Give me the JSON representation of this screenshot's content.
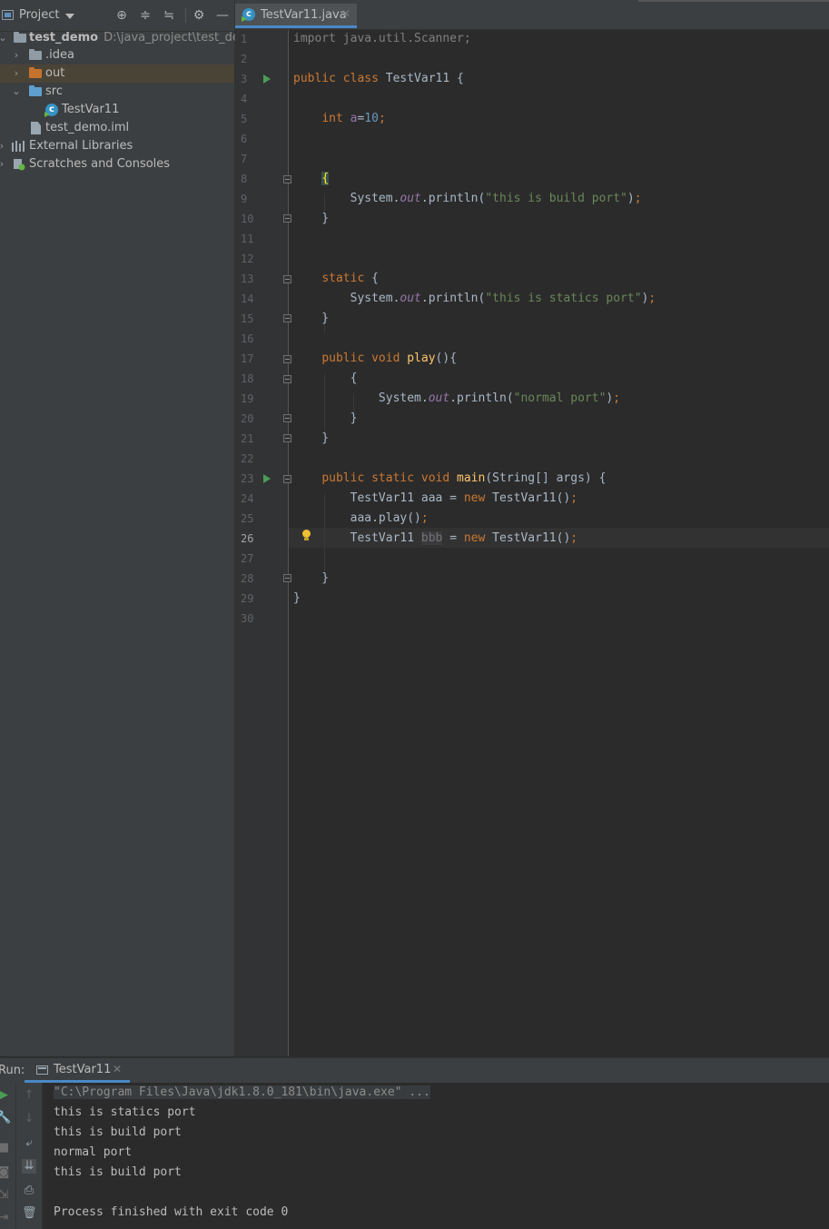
{
  "project_panel": {
    "title": "Project",
    "tree": [
      {
        "label": "test_demo",
        "note": "D:\\java_project\\test_demo"
      },
      {
        "label": ".idea"
      },
      {
        "label": "out"
      },
      {
        "label": "src"
      },
      {
        "label": "TestVar11"
      },
      {
        "label": "test_demo.iml"
      },
      {
        "label": "External Libraries"
      },
      {
        "label": "Scratches and Consoles"
      }
    ]
  },
  "editor": {
    "tab_label": "TestVar11.java",
    "current_line": 26,
    "line_numbers": [
      "1",
      "2",
      "3",
      "4",
      "5",
      "6",
      "7",
      "8",
      "9",
      "10",
      "11",
      "12",
      "13",
      "14",
      "15",
      "16",
      "17",
      "18",
      "19",
      "20",
      "21",
      "22",
      "23",
      "24",
      "25",
      "26",
      "27",
      "28",
      "29",
      "30"
    ]
  },
  "run_panel": {
    "title": "Run:",
    "tab_label": "TestVar11",
    "console_lines": [
      "\"C:\\Program Files\\Java\\jdk1.8.0_181\\bin\\java.exe\" ...",
      "this is statics port",
      "this is build port",
      "normal port",
      "this is build port",
      "",
      "Process finished with exit code 0"
    ]
  },
  "colors": {
    "keyword": "#cc7832",
    "string": "#6a8759",
    "number": "#6897bb",
    "field": "#9876aa",
    "method": "#ffc66d",
    "accent": "#4a88c7"
  }
}
